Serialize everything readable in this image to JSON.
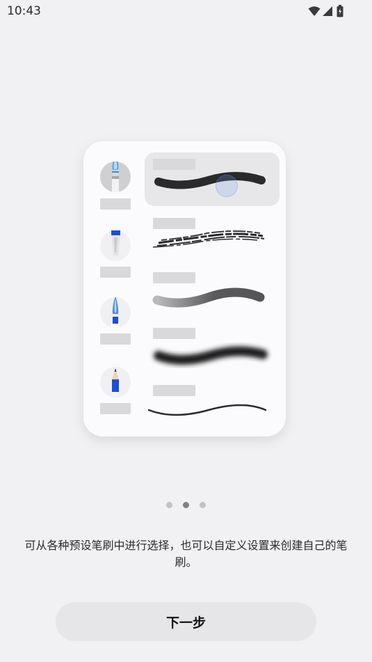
{
  "status_bar": {
    "time": "10:43",
    "icons": [
      "wifi-icon",
      "signal-icon",
      "battery-charging-icon"
    ]
  },
  "illustration": {
    "brushes": [
      {
        "icon": "paint-brush-icon",
        "selected": true
      },
      {
        "icon": "marker-icon",
        "selected": false
      },
      {
        "icon": "pen-nib-icon",
        "selected": false
      },
      {
        "icon": "pencil-icon",
        "selected": false
      }
    ]
  },
  "pager": {
    "count": 3,
    "active_index": 1
  },
  "description": "可从各种预设笔刷中进行选择，也可以自定义设置来创建自己的笔刷。",
  "next_button": {
    "label": "下一步"
  },
  "colors": {
    "background": "#f1f1f3",
    "card": "#fbfbfd",
    "accent_blue": "#1a4fd6",
    "button_bg": "#e6e6e9"
  }
}
